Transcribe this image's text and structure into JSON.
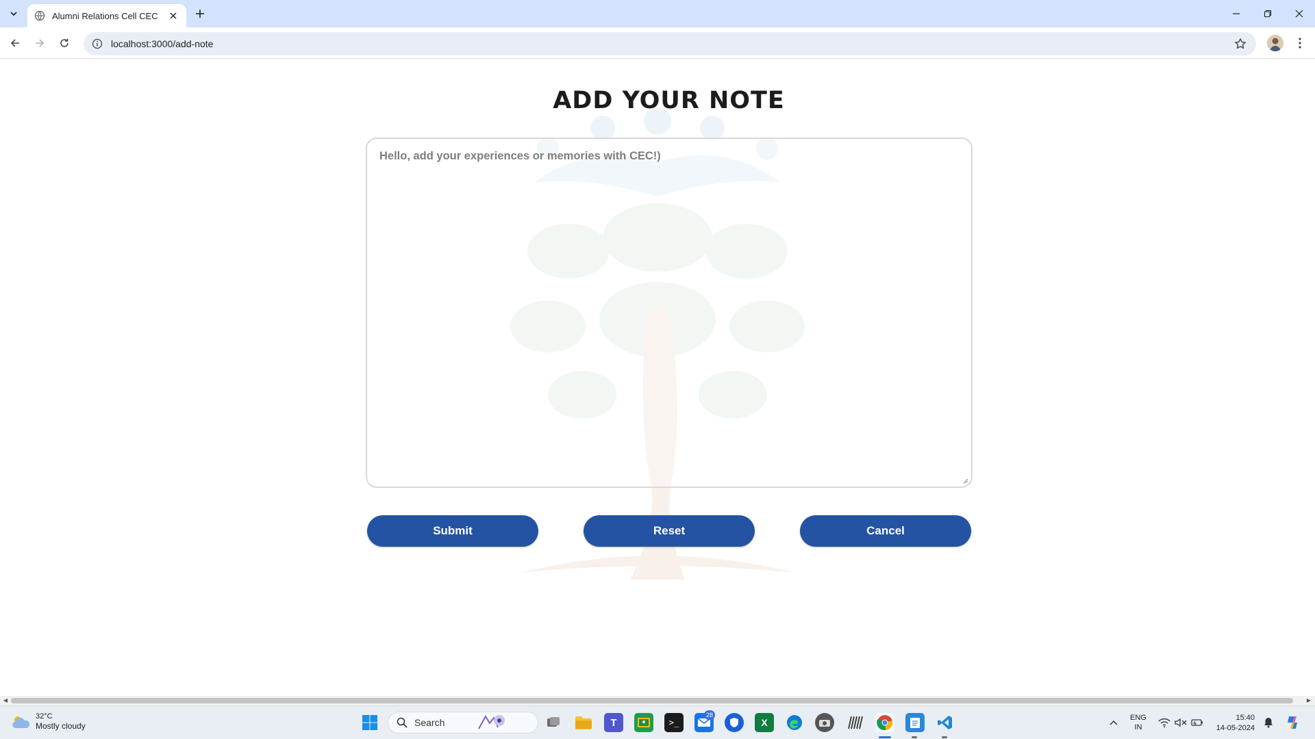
{
  "browser": {
    "tab_title": "Alumni Relations Cell CEC",
    "url": "localhost:3000/add-note"
  },
  "page": {
    "title": "ADD YOUR NOTE",
    "note_placeholder": "Hello, add your experiences or memories with CEC!)",
    "buttons": {
      "submit": "Submit",
      "reset": "Reset",
      "cancel": "Cancel"
    },
    "accent_color": "#2453a4"
  },
  "taskbar": {
    "weather_temp": "32°C",
    "weather_condition": "Mostly cloudy",
    "search_label": "Search",
    "mail_badge": "28",
    "lang_line1": "ENG",
    "lang_line2": "IN",
    "time": "15:40",
    "date": "14-05-2024"
  }
}
